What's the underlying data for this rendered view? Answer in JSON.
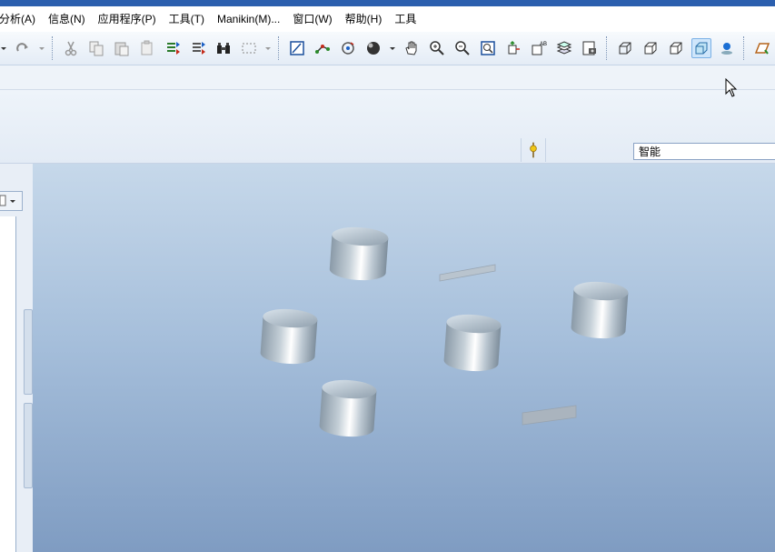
{
  "menu": [
    "分析(A)",
    "信息(N)",
    "应用程序(P)",
    "工具(T)",
    "Manikin(M)...",
    "窗口(W)",
    "帮助(H)",
    "工具"
  ],
  "toolbar_icons": [
    "dropdown-arrow-icon",
    "redo-icon",
    "redo-dropdown-icon",
    "cut-icon",
    "copy-icon",
    "paste-icon",
    "paste-special-icon",
    "regenerate-icon",
    "regenerate-manager-icon",
    "find-icon",
    "select-box-icon",
    "select-dropdown-icon",
    "sketch-icon",
    "datum-icon",
    "spin-center-icon",
    "appearance-icon",
    "appearance-dropdown-icon",
    "pan-icon",
    "zoom-in-icon",
    "zoom-out-icon",
    "refit-icon",
    "reorient-icon",
    "annotation-icon",
    "layers-icon",
    "saved-views-icon",
    "wireframe-icon",
    "hidden-line-icon",
    "no-hidden-icon",
    "shading-icon",
    "enhanced-realism-icon",
    "sketch-plane-icon"
  ],
  "filter_value": "智能",
  "colors": {
    "viewport_top": "#c6d8ea",
    "viewport_bottom": "#7f9cc2",
    "titlebar": "#2b5fae"
  }
}
